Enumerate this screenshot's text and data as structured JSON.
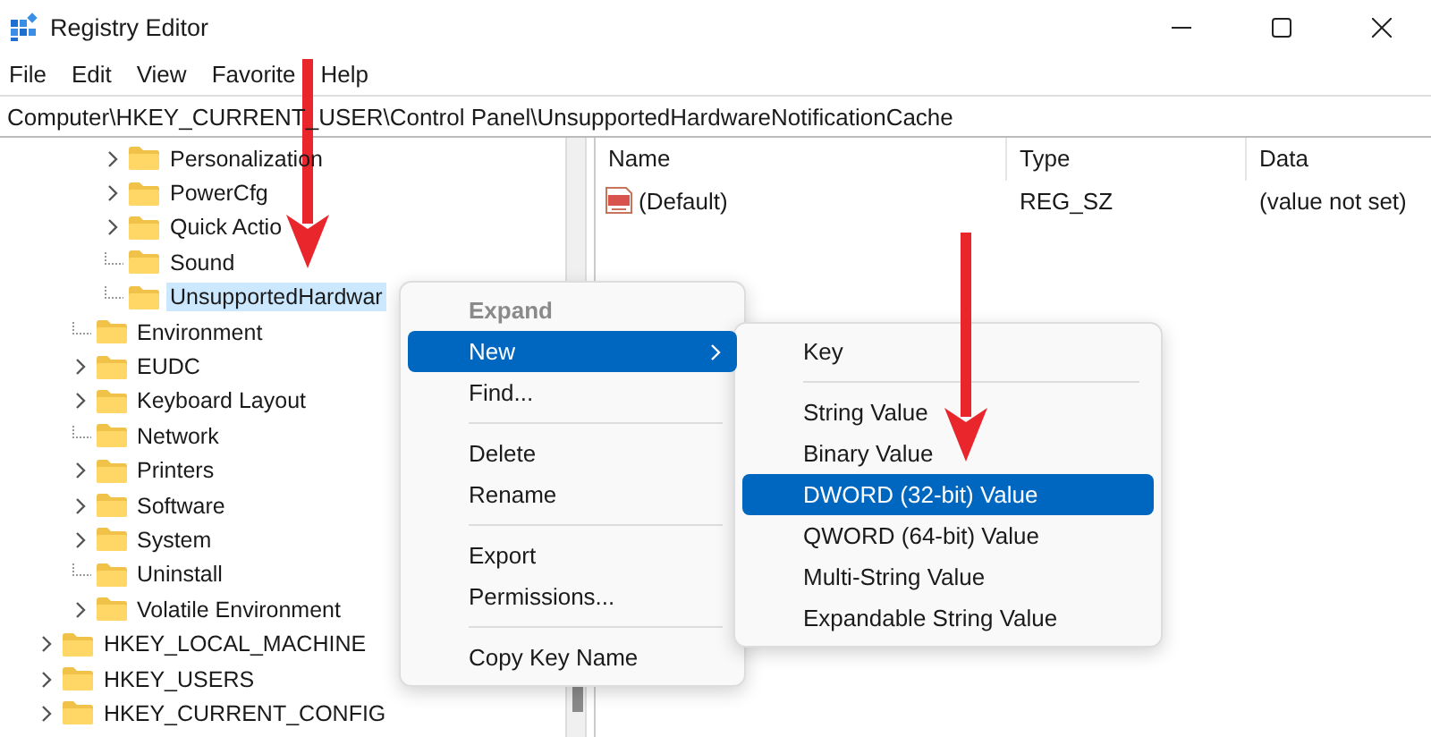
{
  "window": {
    "title": "Registry Editor"
  },
  "menu_bar": [
    "File",
    "Edit",
    "View",
    "Favorite",
    "Help"
  ],
  "address_bar": {
    "value": "Computer\\HKEY_CURRENT_USER\\Control Panel\\UnsupportedHardwareNotificationCache"
  },
  "tree": [
    {
      "children": [
        {
          "children": [
            {
              "label": "Personalization",
              "expandable": true,
              "selected": false
            },
            {
              "label": "PowerCfg",
              "expandable": true,
              "selected": false
            },
            {
              "label": "Quick Actio",
              "expandable": true,
              "selected": false
            },
            {
              "label": "Sound",
              "expandable": false,
              "selected": false
            },
            {
              "label": "UnsupportedHardwar",
              "expandable": false,
              "selected": true
            }
          ]
        },
        {
          "label": "Environment",
          "expandable": false,
          "selected": false
        },
        {
          "label": "EUDC",
          "expandable": true,
          "selected": false
        },
        {
          "label": "Keyboard Layout",
          "expandable": true,
          "selected": false
        },
        {
          "label": "Network",
          "expandable": false,
          "selected": false
        },
        {
          "label": "Printers",
          "expandable": true,
          "selected": false
        },
        {
          "label": "Software",
          "expandable": true,
          "selected": false
        },
        {
          "label": "System",
          "expandable": true,
          "selected": false
        },
        {
          "label": "Uninstall",
          "expandable": false,
          "selected": false
        },
        {
          "label": "Volatile Environment",
          "expandable": true,
          "selected": false
        }
      ]
    },
    {
      "label": "HKEY_LOCAL_MACHINE",
      "expandable": true,
      "selected": false
    },
    {
      "label": "HKEY_USERS",
      "expandable": true,
      "selected": false
    },
    {
      "label": "HKEY_CURRENT_CONFIG",
      "expandable": true,
      "selected": false
    }
  ],
  "values_table": {
    "columns": [
      "Name",
      "Type",
      "Data"
    ],
    "rows": [
      {
        "name": "(Default)",
        "type": "REG_SZ",
        "data": "(value not set)"
      }
    ]
  },
  "context_menu": [
    {
      "kind": "item",
      "label": "Expand",
      "disabled": true,
      "selected": false,
      "submenu": false
    },
    {
      "kind": "item",
      "label": "New",
      "disabled": false,
      "selected": true,
      "submenu": true
    },
    {
      "kind": "item",
      "label": "Find...",
      "disabled": false,
      "selected": false,
      "submenu": false
    },
    {
      "kind": "separator"
    },
    {
      "kind": "item",
      "label": "Delete",
      "disabled": false,
      "selected": false,
      "submenu": false
    },
    {
      "kind": "item",
      "label": "Rename",
      "disabled": false,
      "selected": false,
      "submenu": false
    },
    {
      "kind": "separator"
    },
    {
      "kind": "item",
      "label": "Export",
      "disabled": false,
      "selected": false,
      "submenu": false
    },
    {
      "kind": "item",
      "label": "Permissions...",
      "disabled": false,
      "selected": false,
      "submenu": false
    },
    {
      "kind": "separator"
    },
    {
      "kind": "item",
      "label": "Copy Key Name",
      "disabled": false,
      "selected": false,
      "submenu": false
    }
  ],
  "submenu": [
    {
      "kind": "item",
      "label": "Key",
      "selected": false
    },
    {
      "kind": "separator"
    },
    {
      "kind": "item",
      "label": "String Value",
      "selected": false
    },
    {
      "kind": "item",
      "label": "Binary Value",
      "selected": false
    },
    {
      "kind": "item",
      "label": "DWORD (32-bit) Value",
      "selected": true
    },
    {
      "kind": "item",
      "label": "QWORD (64-bit) Value",
      "selected": false
    },
    {
      "kind": "item",
      "label": "Multi-String Value",
      "selected": false
    },
    {
      "kind": "item",
      "label": "Expandable String Value",
      "selected": false
    }
  ],
  "annotations": [
    {
      "kind": "arrow"
    },
    {
      "kind": "arrow"
    }
  ]
}
